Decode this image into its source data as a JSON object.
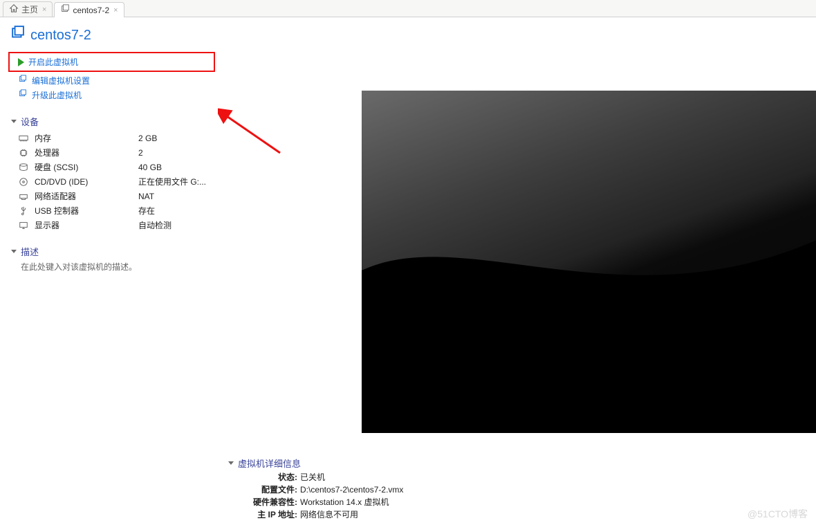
{
  "tabs": [
    {
      "label": "主页"
    },
    {
      "label": "centos7-2"
    }
  ],
  "header": {
    "title": "centos7-2"
  },
  "actions": {
    "power_on": "开启此虚拟机",
    "edit_settings": "编辑虚拟机设置",
    "upgrade": "升级此虚拟机"
  },
  "sections": {
    "devices_title": "设备",
    "description_title": "描述",
    "details_title": "虚拟机详细信息"
  },
  "devices": [
    {
      "icon": "memory-icon",
      "label": "内存",
      "value": "2 GB"
    },
    {
      "icon": "cpu-icon",
      "label": "处理器",
      "value": "2"
    },
    {
      "icon": "disk-icon",
      "label": "硬盘 (SCSI)",
      "value": "40 GB"
    },
    {
      "icon": "cd-icon",
      "label": "CD/DVD (IDE)",
      "value": "正在使用文件 G:..."
    },
    {
      "icon": "network-icon",
      "label": "网络适配器",
      "value": "NAT"
    },
    {
      "icon": "usb-icon",
      "label": "USB 控制器",
      "value": "存在"
    },
    {
      "icon": "display-icon",
      "label": "显示器",
      "value": "自动检测"
    }
  ],
  "description": {
    "placeholder": "在此处键入对该虚拟机的描述。"
  },
  "details": {
    "state_label": "状态:",
    "state_value": "已关机",
    "config_label": "配置文件:",
    "config_value": "D:\\centos7-2\\centos7-2.vmx",
    "compat_label": "硬件兼容性:",
    "compat_value": "Workstation 14.x 虚拟机",
    "ip_label": "主 IP 地址:",
    "ip_value": "网络信息不可用"
  },
  "watermark": "@51CTO博客"
}
